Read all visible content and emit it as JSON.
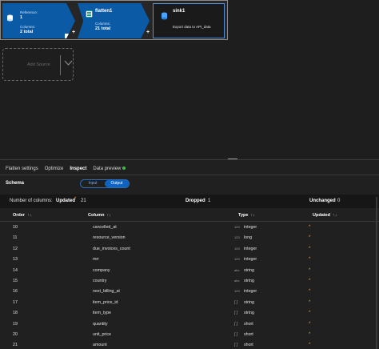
{
  "flow": {
    "node1": {
      "name": "Reference:",
      "id": "1",
      "sub_label": "Columns:",
      "sub_value": "2 total"
    },
    "node2": {
      "name": "flatten1",
      "sub_label": "Columns:",
      "sub_value": "21 total"
    },
    "node3": {
      "name": "sink1",
      "desc": "Export data to API_data"
    },
    "plus": "+"
  },
  "add_source": {
    "label": "Add Source"
  },
  "tabs": [
    "Flatten settings",
    "Optimize",
    "Inspect",
    "Data preview"
  ],
  "schema_label": "Schema",
  "toggle": {
    "input": "Input",
    "output": "Output"
  },
  "stats": {
    "num_columns_label": "Number of columns:",
    "updated_label": "Updated",
    "updated_value": "21",
    "dropped_label": "Dropped",
    "dropped_value": "1",
    "unchanged_label": "Unchanged",
    "unchanged_value": "0"
  },
  "table": {
    "headers": {
      "order": "Order",
      "column": "Column",
      "type": "Type",
      "updated": "Updated"
    },
    "rows": [
      {
        "order": "10",
        "column": "cancelled_at",
        "type_icon": "123",
        "type": "integer",
        "updated": "*"
      },
      {
        "order": "11",
        "column": "resource_version",
        "type_icon": "123",
        "type": "long",
        "updated": "*"
      },
      {
        "order": "12",
        "column": "due_invoices_count",
        "type_icon": "123",
        "type": "integer",
        "updated": "*"
      },
      {
        "order": "13",
        "column": "mrr",
        "type_icon": "123",
        "type": "integer",
        "updated": "*"
      },
      {
        "order": "14",
        "column": "company",
        "type_icon": "abc",
        "type": "string",
        "updated": "*"
      },
      {
        "order": "15",
        "column": "country",
        "type_icon": "abc",
        "type": "string",
        "updated": "*"
      },
      {
        "order": "16",
        "column": "next_billing_at",
        "type_icon": "123",
        "type": "integer",
        "updated": "*"
      },
      {
        "order": "17",
        "column": "item_price_id",
        "type_icon": "[ ]",
        "type": "string",
        "updated": "*"
      },
      {
        "order": "18",
        "column": "item_type",
        "type_icon": "[ ]",
        "type": "string",
        "updated": "*"
      },
      {
        "order": "19",
        "column": "quantity",
        "type_icon": "[ ]",
        "type": "short",
        "updated": "*"
      },
      {
        "order": "20",
        "column": "unit_price",
        "type_icon": "[ ]",
        "type": "short",
        "updated": "*"
      },
      {
        "order": "21",
        "column": "amount",
        "type_icon": "[ ]",
        "type": "short",
        "updated": "*"
      }
    ]
  },
  "colors": {
    "node_blue": "#0a5aa6",
    "accent": "#0d64c2",
    "updated_mark": "#e8a33d",
    "data_preview_dot": "#3ebd4b"
  }
}
